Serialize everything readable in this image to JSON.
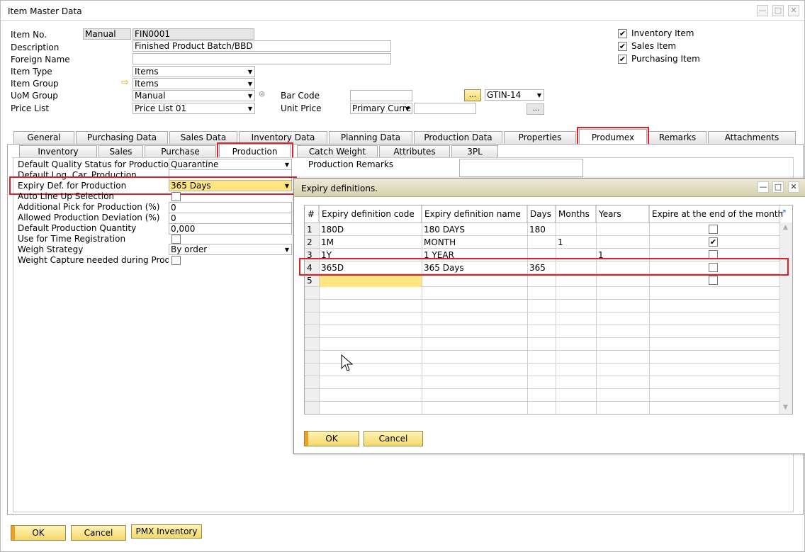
{
  "window": {
    "title": "Item Master Data",
    "controls": [
      "—",
      "□",
      "✕"
    ]
  },
  "header": {
    "item_no_label": "Item No.",
    "numbering_series": "Manual",
    "item_no": "FIN0001",
    "description_label": "Description",
    "description": "Finished Product Batch/BBD",
    "foreign_name_label": "Foreign Name",
    "foreign_name": "",
    "item_type_label": "Item Type",
    "item_type": "Items",
    "item_group_label": "Item Group",
    "item_group": "Items",
    "uom_group_label": "UoM Group",
    "uom_group": "Manual",
    "price_list_label": "Price List",
    "price_list": "Price List 01",
    "bar_code_label": "Bar Code",
    "bar_code": "",
    "bar_code_browse": "...",
    "bar_code_type": "GTIN-14",
    "unit_price_label": "Unit Price",
    "unit_price_currency": "Primary Curren",
    "unit_price": "",
    "unit_price_browse": "...",
    "inventory_item_label": "Inventory Item",
    "sales_item_label": "Sales Item",
    "purchasing_item_label": "Purchasing Item",
    "inventory_item": true,
    "sales_item": true,
    "purchasing_item": true
  },
  "main_tabs": [
    "General",
    "Purchasing Data",
    "Sales Data",
    "Inventory Data",
    "Planning Data",
    "Production Data",
    "Properties",
    "Produmex",
    "Remarks",
    "Attachments"
  ],
  "sub_tabs": [
    "Inventory",
    "Sales",
    "Purchase",
    "Production",
    "Catch Weight",
    "Attributes",
    "3PL"
  ],
  "production": {
    "quality_status_label": "Default Quality Status for Production",
    "quality_status": "Quarantine",
    "log_car_label": "Default Log. Car. Production",
    "log_car": "",
    "expiry_def_label": "Expiry Def. for Production",
    "expiry_def": "365 Days",
    "auto_line_up_label": "Auto Line Up Selection",
    "additional_pick_label": "Additional Pick for Production (%)",
    "additional_pick": "0",
    "allowed_deviation_label": "Allowed Production Deviation (%)",
    "allowed_deviation": "0",
    "default_qty_label": "Default Production Quantity",
    "default_qty": "0,000",
    "time_registration_label": "Use for Time Registration",
    "weigh_strategy_label": "Weigh Strategy",
    "weigh_strategy": "By order",
    "weight_capture_label": "Weight Capture needed during Produc",
    "remarks_label": "Production Remarks"
  },
  "footer": {
    "ok": "OK",
    "cancel": "Cancel",
    "pmx_inventory": "PMX Inventory"
  },
  "expiry_dialog": {
    "title": "Expiry definitions.",
    "columns": [
      "#",
      "Expiry definition code",
      "Expiry definition name",
      "Days",
      "Months",
      "Years",
      "Expire at the end of the month"
    ],
    "rows": [
      {
        "num": "1",
        "code": "180D",
        "name": "180 DAYS",
        "days": "180",
        "months": "",
        "years": "",
        "eom": false
      },
      {
        "num": "2",
        "code": "1M",
        "name": "MONTH",
        "days": "",
        "months": "1",
        "years": "",
        "eom": true
      },
      {
        "num": "3",
        "code": "1Y",
        "name": "1 YEAR",
        "days": "",
        "months": "",
        "years": "1",
        "eom": false
      },
      {
        "num": "4",
        "code": "365D",
        "name": "365 Days",
        "days": "365",
        "months": "",
        "years": "",
        "eom": false
      },
      {
        "num": "5",
        "code": "",
        "name": "",
        "days": "",
        "months": "",
        "years": "",
        "eom": false
      }
    ],
    "ok": "OK",
    "cancel": "Cancel"
  },
  "colors": {
    "highlight_red": "#e0202a",
    "button_yellow": "#f5d86a",
    "active_row_yellow": "#ffe680"
  }
}
